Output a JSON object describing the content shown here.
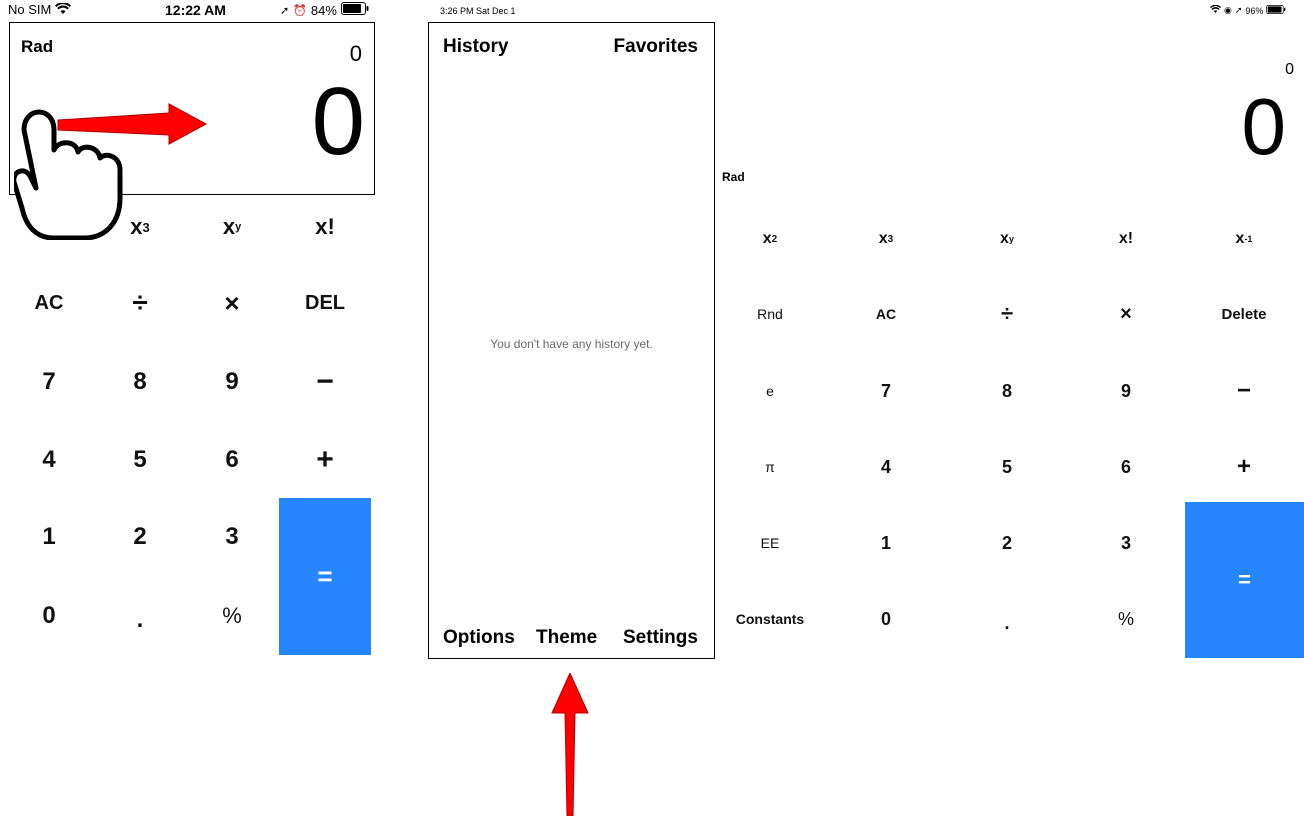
{
  "phone": {
    "status": {
      "carrier": "No SIM",
      "time": "12:22 AM",
      "battery": "84%"
    },
    "display": {
      "mode": "Rad",
      "expression": "0",
      "result": "0"
    },
    "keys": {
      "row_powers": [
        "x",
        "x",
        "x!"
      ],
      "row_powers_sup": [
        "3",
        "y",
        ""
      ],
      "row_ops": [
        "AC",
        "÷",
        "×",
        "DEL"
      ],
      "row_789": [
        "7",
        "8",
        "9",
        "−"
      ],
      "row_456": [
        "4",
        "5",
        "6",
        "+"
      ],
      "row_123": [
        "1",
        "2",
        "3"
      ],
      "row_0": [
        "0",
        ".",
        "%"
      ],
      "equals": "="
    }
  },
  "history_panel": {
    "status": {
      "time_date": "3:26 PM  Sat Dec 1"
    },
    "tabs": {
      "history": "History",
      "favorites": "Favorites"
    },
    "empty_message": "You don't have any history yet.",
    "footer": {
      "options": "Options",
      "theme": "Theme",
      "settings": "Settings"
    }
  },
  "tablet": {
    "status": {
      "battery": "96%"
    },
    "display": {
      "mode": "Rad",
      "expression": "0",
      "result": "0"
    },
    "keys": {
      "col1": [
        "x",
        "Rnd",
        "e",
        "π",
        "EE",
        "Constants"
      ],
      "col1_sup": [
        "2"
      ],
      "col2": [
        "x",
        "AC",
        "7",
        "4",
        "1",
        "0"
      ],
      "col2_sup": [
        "3"
      ],
      "col3": [
        "x",
        "÷",
        "8",
        "5",
        "2",
        "."
      ],
      "col3_sup": [
        "y"
      ],
      "col4": [
        "x!",
        "×",
        "9",
        "6",
        "3",
        "%"
      ],
      "col5": [
        "x",
        "Delete",
        "−",
        "+"
      ],
      "col5_sup": [
        "-1"
      ],
      "equals": "="
    }
  },
  "annotations": {
    "arrow_color": "#ff0000",
    "equals_color": "#2586ff"
  }
}
